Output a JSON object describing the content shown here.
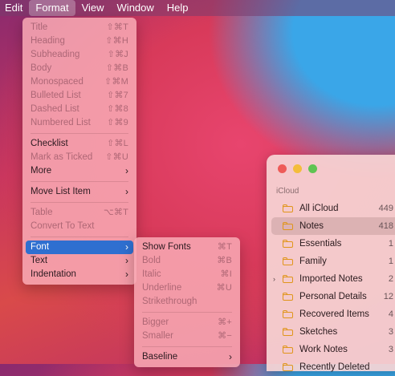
{
  "menubar": {
    "items": [
      {
        "label": "Edit"
      },
      {
        "label": "Format"
      },
      {
        "label": "View"
      },
      {
        "label": "Window"
      },
      {
        "label": "Help"
      }
    ],
    "active": "Format"
  },
  "format_menu": {
    "items": [
      {
        "label": "Title",
        "shortcut": "⇧⌘T",
        "enabled": false
      },
      {
        "label": "Heading",
        "shortcut": "⇧⌘H",
        "enabled": false
      },
      {
        "label": "Subheading",
        "shortcut": "⇧⌘J",
        "enabled": false
      },
      {
        "label": "Body",
        "shortcut": "⇧⌘B",
        "enabled": false
      },
      {
        "label": "Monospaced",
        "shortcut": "⇧⌘M",
        "enabled": false
      },
      {
        "label": "Bulleted List",
        "shortcut": "⇧⌘7",
        "enabled": false
      },
      {
        "label": "Dashed List",
        "shortcut": "⇧⌘8",
        "enabled": false
      },
      {
        "label": "Numbered List",
        "shortcut": "⇧⌘9",
        "enabled": false
      },
      {
        "label": "Checklist",
        "shortcut": "⇧⌘L",
        "enabled": true
      },
      {
        "label": "Mark as Ticked",
        "shortcut": "⇧⌘U",
        "enabled": false
      },
      {
        "label": "More",
        "shortcut": "›",
        "enabled": true
      },
      {
        "label": "Move List Item",
        "shortcut": "›",
        "enabled": true
      },
      {
        "label": "Table",
        "shortcut": "⌥⌘T",
        "enabled": false
      },
      {
        "label": "Convert To Text",
        "shortcut": "",
        "enabled": false
      },
      {
        "label": "Font",
        "shortcut": "›",
        "enabled": true,
        "selected": true
      },
      {
        "label": "Text",
        "shortcut": "›",
        "enabled": true
      },
      {
        "label": "Indentation",
        "shortcut": "›",
        "enabled": true
      }
    ]
  },
  "font_submenu": {
    "items": [
      {
        "label": "Show Fonts",
        "shortcut": "⌘T",
        "enabled": true
      },
      {
        "label": "Bold",
        "shortcut": "⌘B",
        "enabled": false
      },
      {
        "label": "Italic",
        "shortcut": "⌘I",
        "enabled": false
      },
      {
        "label": "Underline",
        "shortcut": "⌘U",
        "enabled": false
      },
      {
        "label": "Strikethrough",
        "shortcut": "",
        "enabled": false
      },
      {
        "label": "Bigger",
        "shortcut": "⌘+",
        "enabled": false
      },
      {
        "label": "Smaller",
        "shortcut": "⌘−",
        "enabled": false
      },
      {
        "label": "Baseline",
        "shortcut": "›",
        "enabled": true
      }
    ]
  },
  "notes_window": {
    "section_label": "iCloud",
    "folders": [
      {
        "name": "All iCloud",
        "count": "449"
      },
      {
        "name": "Notes",
        "count": "418",
        "selected": true
      },
      {
        "name": "Essentials",
        "count": "1"
      },
      {
        "name": "Family",
        "count": "1"
      },
      {
        "name": "Imported Notes",
        "count": "2",
        "expandable": true
      },
      {
        "name": "Personal Details",
        "count": "12"
      },
      {
        "name": "Recovered Items",
        "count": "4"
      },
      {
        "name": "Sketches",
        "count": "3"
      },
      {
        "name": "Work Notes",
        "count": "3"
      },
      {
        "name": "Recently Deleted",
        "count": ""
      }
    ]
  },
  "colors": {
    "selection": "#2f6fd0",
    "close": "#ee5b58",
    "minimize": "#f4bd3b",
    "zoom": "#5fc452",
    "folder_icon": "#e0951a"
  }
}
